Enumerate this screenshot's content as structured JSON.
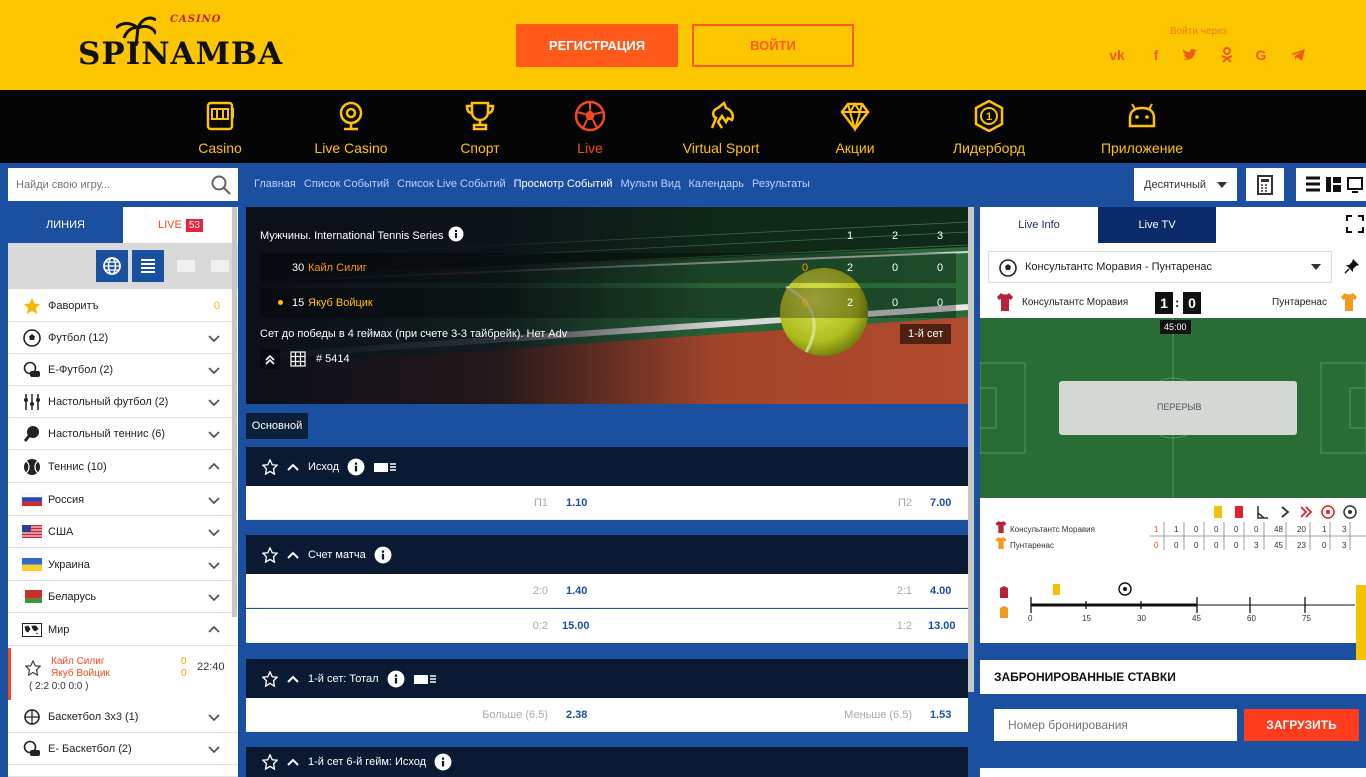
{
  "brand": {
    "small": "CASINO",
    "name": "SPINAMBA"
  },
  "header": {
    "register": "РЕГИСТРАЦИЯ",
    "login": "ВОЙТИ",
    "social_label": "Войти через",
    "social": [
      "vk-icon",
      "facebook-icon",
      "twitter-icon",
      "odnoklassniki-icon",
      "google-icon",
      "telegram-icon"
    ]
  },
  "nav": [
    {
      "label": "Casino",
      "icon": "slot-machine-icon"
    },
    {
      "label": "Live Casino",
      "icon": "webcam-icon"
    },
    {
      "label": "Спорт",
      "icon": "trophy-icon"
    },
    {
      "label": "Live",
      "icon": "soccer-ball-icon",
      "active": true
    },
    {
      "label": "Virtual Sport",
      "icon": "horse-icon"
    },
    {
      "label": "Акции",
      "icon": "diamond-icon"
    },
    {
      "label": "Лидерборд",
      "icon": "medal-icon"
    },
    {
      "label": "Приложение",
      "icon": "android-icon"
    }
  ],
  "search": {
    "placeholder": "Найди свою игру..."
  },
  "breadcrumbs": [
    "Главная",
    "Список Событий",
    "Список Live Событий",
    "Просмотр Событий",
    "Мульти Вид",
    "Календарь",
    "Результаты"
  ],
  "odds_format": "Десятичный",
  "sidebar": {
    "tab_line": "ЛИНИЯ",
    "tab_live": "LIVE",
    "live_count": "53",
    "items": [
      {
        "label": "Фаворитъ",
        "count": "0",
        "icon": "star-icon"
      },
      {
        "label": "Футбол (12)",
        "icon": "soccer-ball-icon"
      },
      {
        "label": "E-Футбол (2)",
        "icon": "esoccer-icon"
      },
      {
        "label": "Настольный футбол (2)",
        "icon": "table-football-icon"
      },
      {
        "label": "Настольный теннис (6)",
        "icon": "table-tennis-icon"
      },
      {
        "label": "Теннис (10)",
        "icon": "tennis-ball-icon"
      },
      {
        "label": "Россия",
        "icon": "russia-flag-icon"
      },
      {
        "label": "США",
        "icon": "usa-flag-icon"
      },
      {
        "label": "Украина",
        "icon": "ukraine-flag-icon"
      },
      {
        "label": "Беларусь",
        "icon": "belarus-flag-icon"
      },
      {
        "label": "Мир",
        "icon": "world-map-icon"
      }
    ],
    "event": {
      "p1": "Кайл Силиг",
      "p2": "Якуб Войцик",
      "s1": "0",
      "s2": "0",
      "time": "22:40",
      "score": "( 2:2  0:0  0:0 )"
    },
    "more": [
      {
        "label": "Баскетбол 3х3 (1)",
        "icon": "basketball-3x3-icon"
      },
      {
        "label": "E- Баскетбол (2)",
        "icon": "ebasketball-icon"
      }
    ]
  },
  "event": {
    "league": "Мужчины. International Tennis Series",
    "cols": [
      "1",
      "2",
      "3"
    ],
    "p1": {
      "seed": "30",
      "name": "Кайл Силиг",
      "game": "0",
      "sets": [
        "2",
        "0",
        "0"
      ]
    },
    "p2": {
      "seed": "15",
      "name": "Якуб Войцик",
      "game": "0",
      "sets": [
        "2",
        "0",
        "0"
      ]
    },
    "rule": "Сет до победы в 4 геймах (при счете 3-3 тайбрейк). Нет Adv",
    "set_label": "1-й сет",
    "id": "# 5414"
  },
  "market_tag": "Основной",
  "markets": [
    {
      "title": "Исход",
      "rows": [
        {
          "l1": "П1",
          "v1": "1.10",
          "l2": "П2",
          "v2": "7.00"
        }
      ]
    },
    {
      "title": "Счет матча",
      "rows": [
        {
          "l1": "2:0",
          "v1": "1.40",
          "l2": "2:1",
          "v2": "4.00"
        },
        {
          "l1": "0:2",
          "v1": "15.00",
          "l2": "1:2",
          "v2": "13.00"
        }
      ]
    },
    {
      "title": "1-й сет: Тотал",
      "rows": [
        {
          "l1": "Больше (6.5)",
          "v1": "2.38",
          "l2": "Меньше (6.5)",
          "v2": "1.53"
        }
      ]
    },
    {
      "title": "1-й сет 6-й гейм: Исход",
      "rows": []
    }
  ],
  "right": {
    "tab_info": "Live Info",
    "tab_tv": "Live TV",
    "match": "Консультантс Моравия - Пунтаренас",
    "home": "Консультантс Моравия",
    "away": "Пунтаренас",
    "hs": "1",
    "as": "0",
    "clock": "45:00",
    "status": "ПЕРЕРЫВ",
    "stats": [
      {
        "team": "Консультантс Моравия",
        "vals": [
          "1",
          "1",
          "0",
          "0",
          "0",
          "0",
          "48",
          "20",
          "1",
          "3"
        ]
      },
      {
        "team": "Пунтаренас",
        "vals": [
          "0",
          "0",
          "0",
          "0",
          "0",
          "3",
          "45",
          "23",
          "0",
          "3"
        ]
      }
    ],
    "timeline": [
      "0",
      "15",
      "30",
      "45",
      "60",
      "75"
    ],
    "booked_title": "ЗАБРОНИРОВАННЫЕ СТАВКИ",
    "booked_placeholder": "Номер бронирования",
    "booked_button": "ЗАГРУЗИТЬ"
  },
  "colors": {
    "header": "#fcc600",
    "nav": "#050505",
    "accent": "#ff5a1c",
    "page": "#1b4fa0",
    "live": "#f44a1e"
  }
}
